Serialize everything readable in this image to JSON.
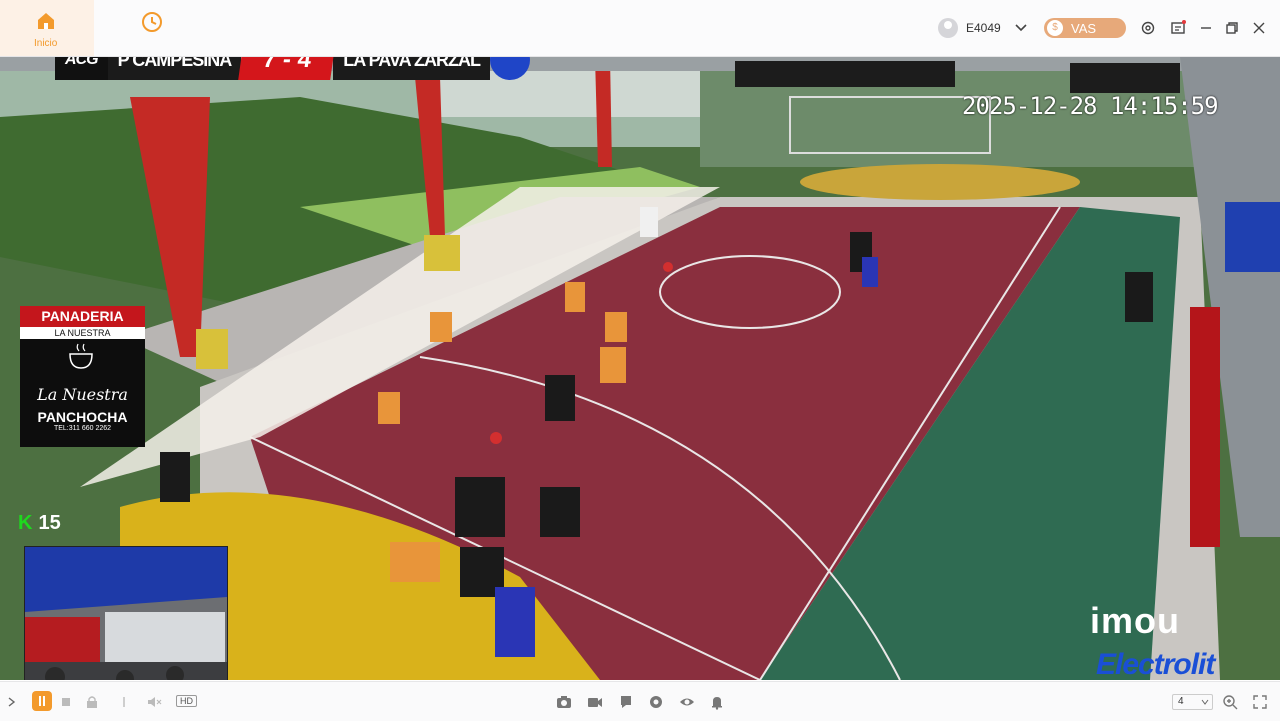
{
  "nav": {
    "home_label": "Inicio",
    "home_icon": "home-icon",
    "history_icon": "history-icon"
  },
  "user": {
    "account": "E4049"
  },
  "vas": {
    "label": "VAS"
  },
  "overlay": {
    "scoreboard": {
      "league": "ACG",
      "home_team": "P CAMPESINA",
      "result": "7 - 4",
      "away_team": "LA PAVA ZARZAL"
    },
    "timestamp": "2025-12-28 14:15:59",
    "sponsor": {
      "title": "PANADERIA",
      "subtitle": "LA NUESTRA",
      "logo_text": "La Nuestra",
      "name": "PANCHOCHA",
      "tel": "TEL:311 660 2262"
    },
    "viewers": {
      "platform_glyph": "K",
      "count": "15"
    },
    "brand": {
      "imou": "imou",
      "electro": "Electrolit"
    }
  },
  "bottombar": {
    "quality_badge": "HD",
    "grid_value": "4"
  },
  "colors": {
    "accent": "#f39a2c",
    "vas": "#e7a97a",
    "score_red": "#d4161b",
    "court_red": "#8a2f3e",
    "court_green": "#2f6b52"
  }
}
